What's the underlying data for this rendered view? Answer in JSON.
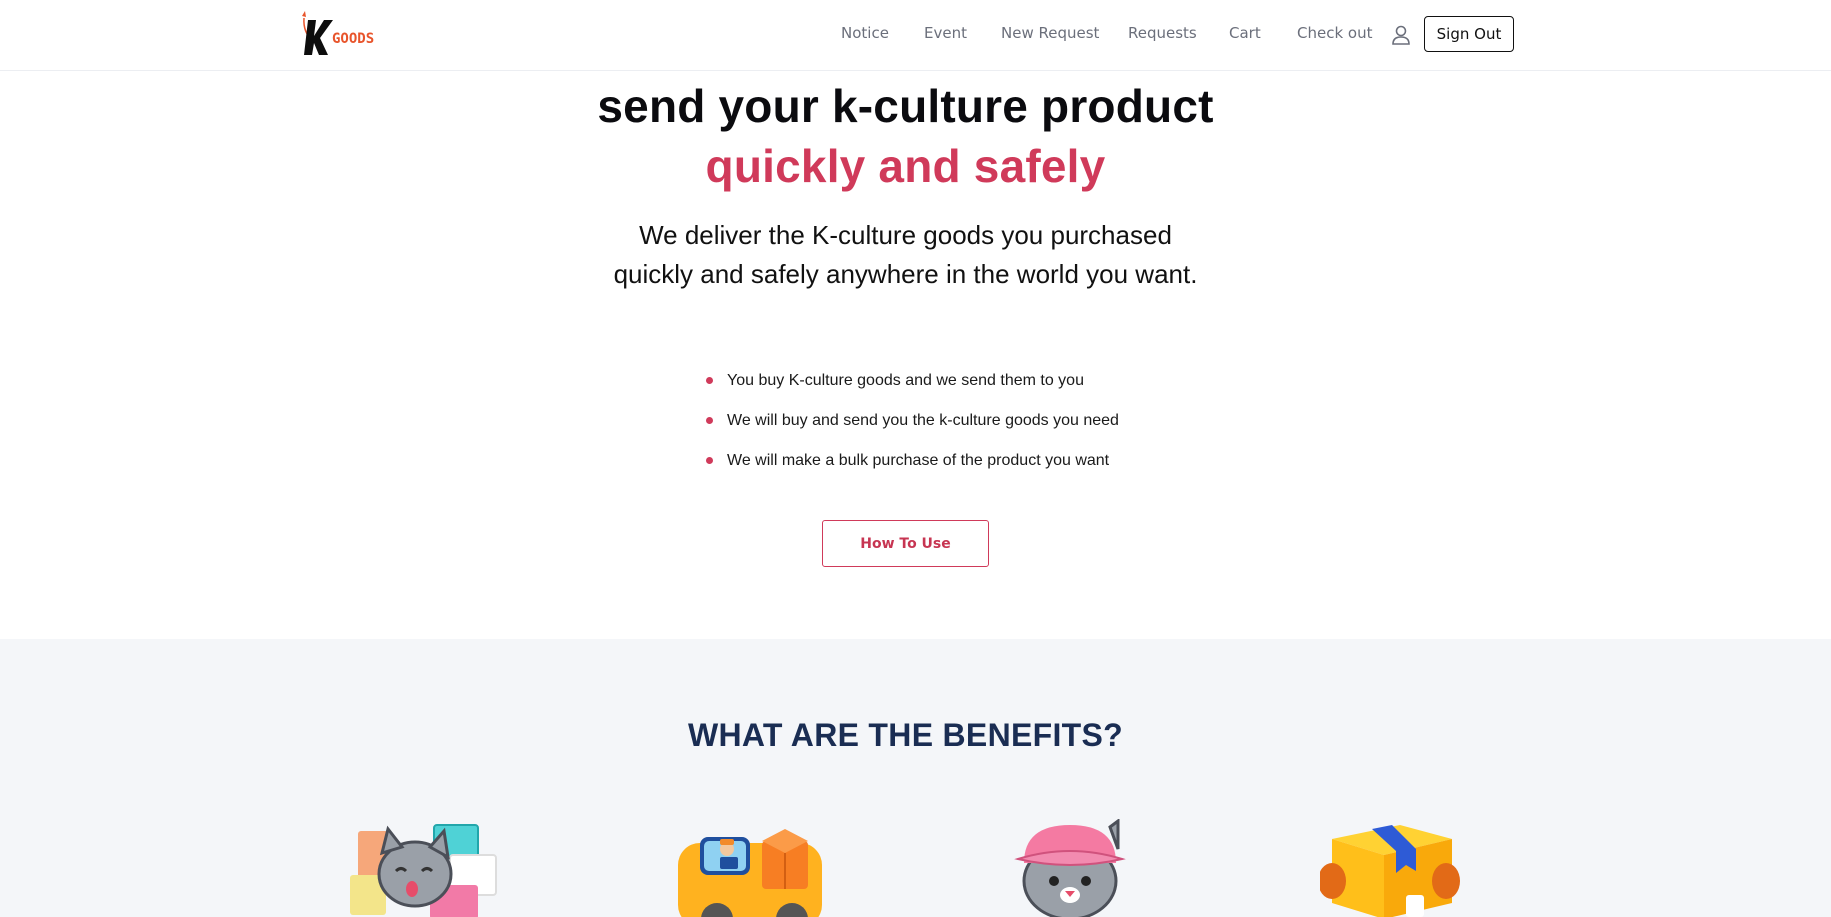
{
  "header": {
    "logo_text": "GOODS",
    "nav": [
      "Notice",
      "Event",
      "New Request",
      "Requests",
      "Cart",
      "Check out"
    ],
    "user_icon": "user-icon",
    "sign_out_label": "Sign Out"
  },
  "hero": {
    "title_line1": "send your k-culture product",
    "title_line2": "quickly and safely",
    "subtitle": "We deliver the K-culture goods you purchased quickly and safely anywhere in the world you want.",
    "bullets": [
      "You buy K-culture goods and we send them to you",
      "We will buy and send you the k-culture goods you need",
      "We will make a bulk purchase of the product you want"
    ],
    "cta_label": "How To Use"
  },
  "benefits": {
    "title": "WHAT ARE THE BENEFITS?",
    "illustrations": [
      "cat-with-gifts-icon",
      "delivery-truck-icon",
      "cat-with-cap-icon",
      "package-box-icon"
    ]
  },
  "colors": {
    "accent": "#d03a5a",
    "heading_dark": "#1a2d53",
    "logo_orange": "#e8542b",
    "section_bg": "#f4f6f9"
  }
}
